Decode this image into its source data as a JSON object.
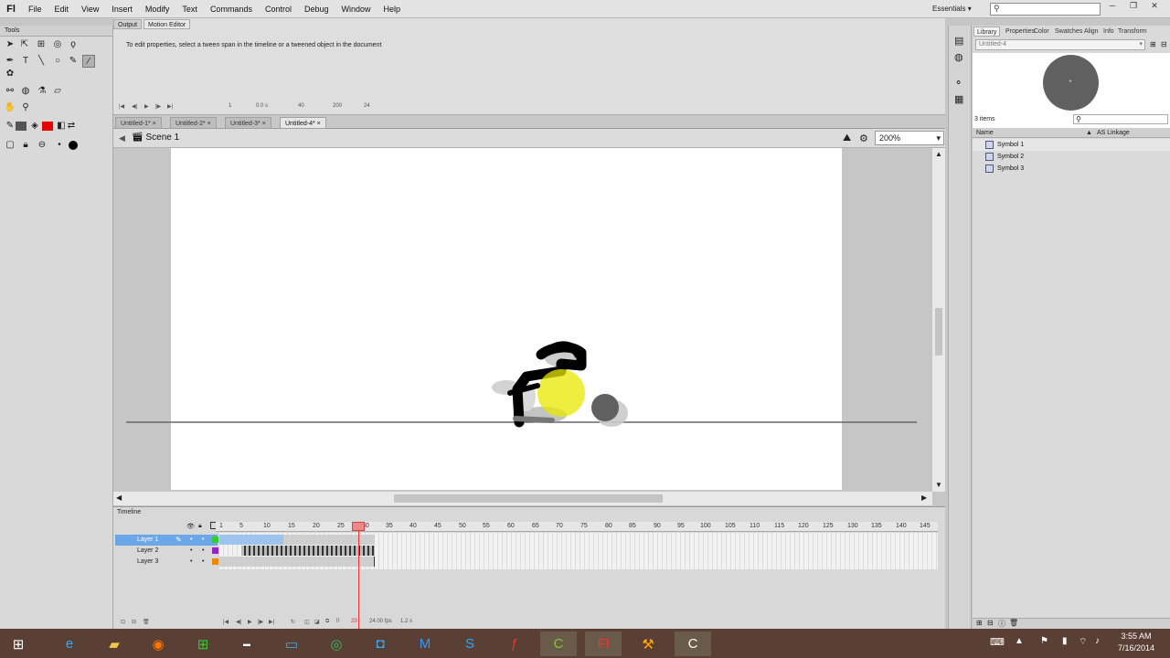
{
  "menu": {
    "logo": "Fl",
    "items": [
      "File",
      "Edit",
      "View",
      "Insert",
      "Modify",
      "Text",
      "Commands",
      "Control",
      "Debug",
      "Window",
      "Help"
    ],
    "workspace": "Essentials"
  },
  "tools": {
    "title": "Tools"
  },
  "panel_tabs": {
    "output": "Output",
    "motion_editor": "Motion Editor"
  },
  "motion_editor": {
    "message": "To edit properties, select a tween span in the timeline or a tweened object in the document",
    "controls": {
      "frame": "1",
      "time": "0.0 s",
      "a": "40",
      "b": "200",
      "c": "24"
    }
  },
  "doc_tabs": [
    {
      "label": "Untitled-1*"
    },
    {
      "label": "Untitled-2*"
    },
    {
      "label": "Untitled-3*"
    },
    {
      "label": "Untitled-4*"
    }
  ],
  "editbar": {
    "scene": "Scene 1",
    "zoom": "200%"
  },
  "timeline": {
    "title": "Timeline",
    "ruler": [
      "1",
      "5",
      "10",
      "15",
      "20",
      "25",
      "30",
      "35",
      "40",
      "45",
      "50",
      "55",
      "60",
      "65",
      "70",
      "75",
      "80",
      "85",
      "90",
      "95",
      "100",
      "105",
      "110",
      "115",
      "120",
      "125",
      "130",
      "135",
      "140",
      "145"
    ],
    "layers": [
      {
        "name": "Layer 1"
      },
      {
        "name": "Layer 2"
      },
      {
        "name": "Layer 3"
      }
    ],
    "status": {
      "frame": "29",
      "fps": "24.00 fps",
      "time": "1.2 s"
    }
  },
  "library": {
    "tabs": [
      "Library",
      "Properties",
      "Color",
      "Swatches",
      "Align",
      "Info",
      "Transform"
    ],
    "document": "Untitled-4",
    "count": "3 items",
    "col_name": "Name",
    "col_linkage": "AS Linkage",
    "items": [
      {
        "name": "Symbol 1"
      },
      {
        "name": "Symbol 2"
      },
      {
        "name": "Symbol 3"
      }
    ]
  },
  "taskbar": {
    "time": "3:55 AM",
    "date": "7/16/2014"
  }
}
